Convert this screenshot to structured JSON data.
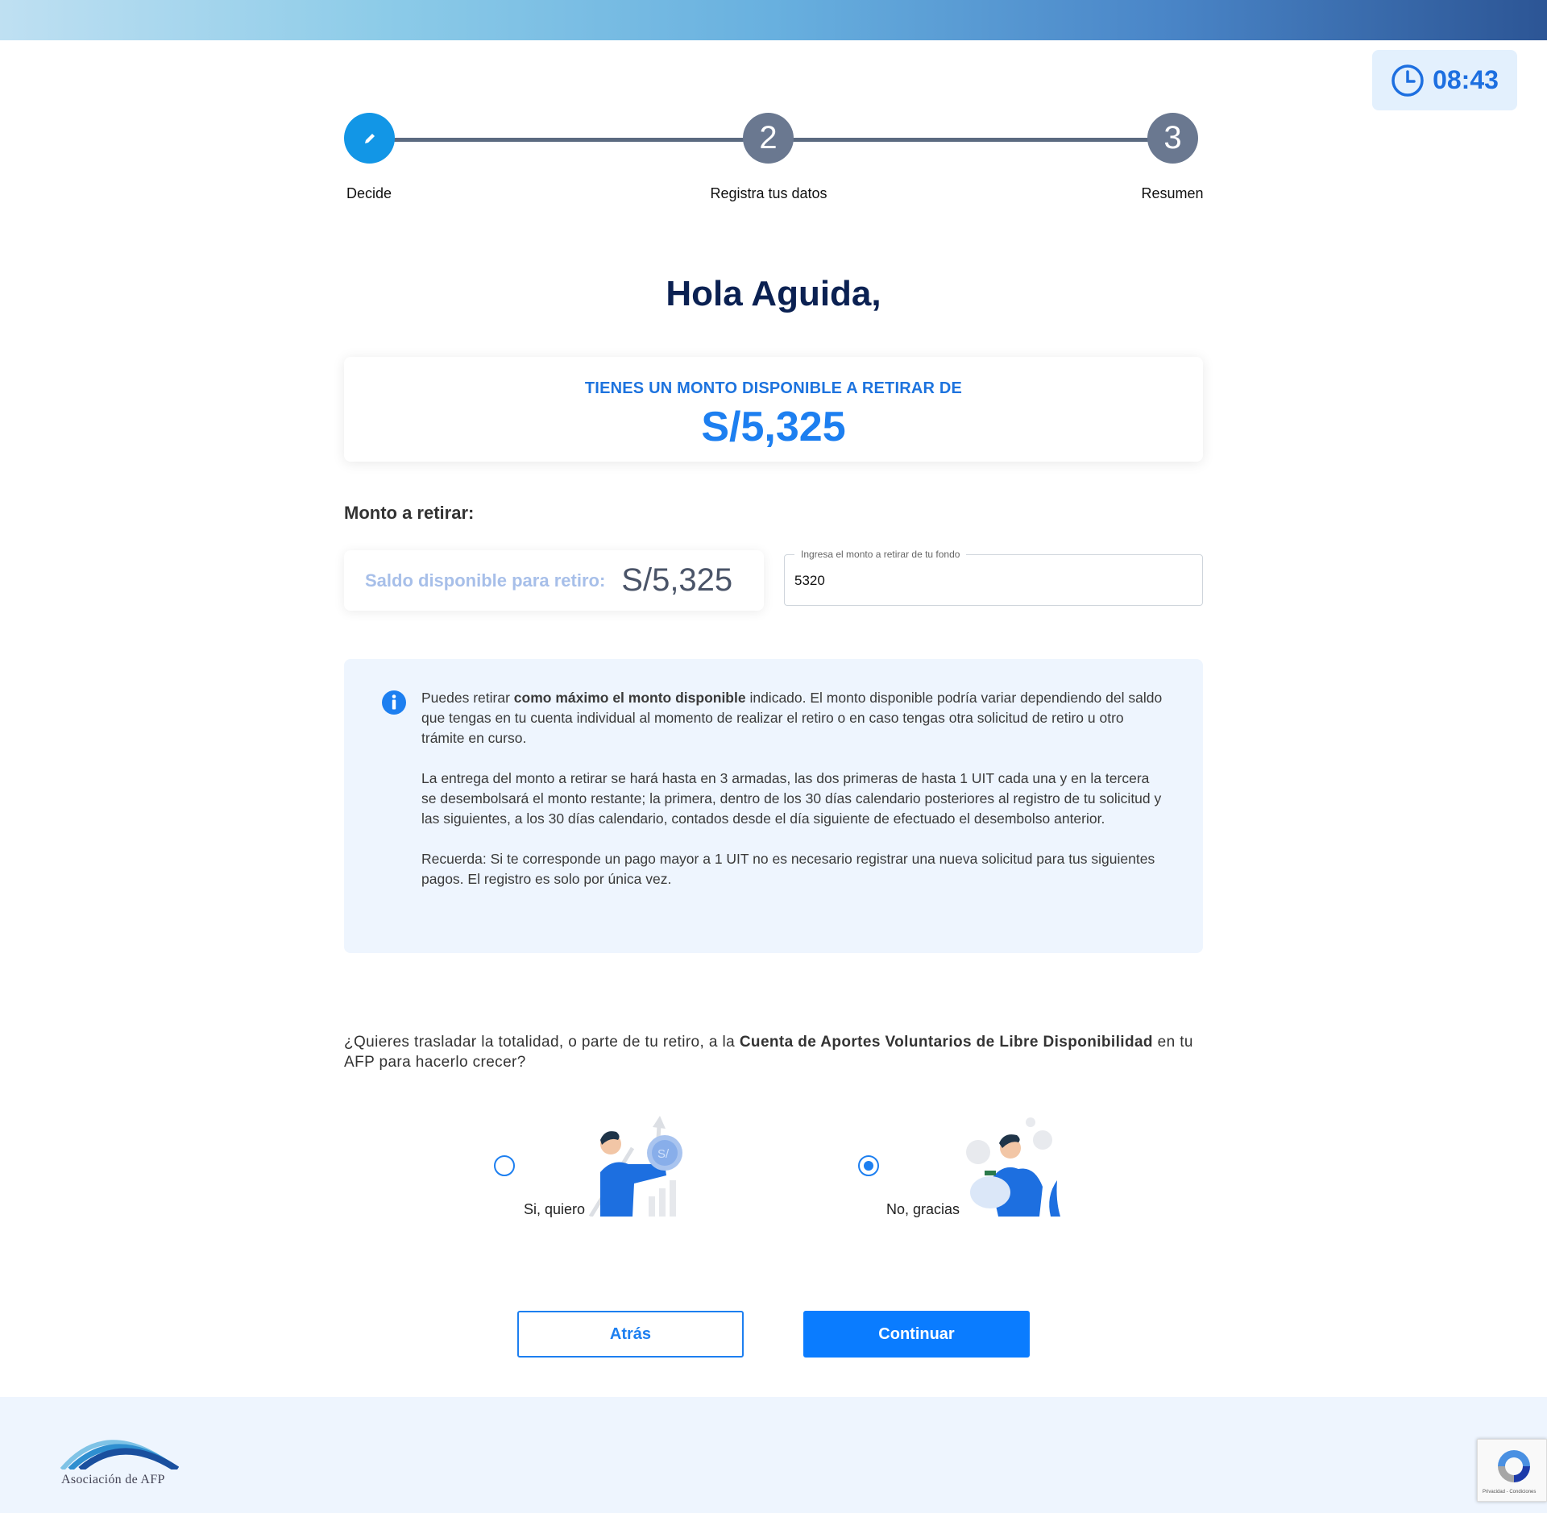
{
  "timer": {
    "value": "08:43",
    "icon": "clock-icon"
  },
  "stepper": {
    "steps": [
      {
        "number": "",
        "label": "Decide",
        "state": "active",
        "icon": "pencil-icon"
      },
      {
        "number": "2",
        "label": "Registra tus datos",
        "state": "pending"
      },
      {
        "number": "3",
        "label": "Resumen",
        "state": "pending"
      }
    ]
  },
  "greeting": "Hola Aguida,",
  "available_card": {
    "label": "TIENES UN MONTO DISPONIBLE A RETIRAR DE",
    "amount": "S/5,325"
  },
  "withdraw": {
    "title": "Monto a retirar:",
    "balance_label": "Saldo disponible para retiro:",
    "balance_value": "S/5,325",
    "input_label": "Ingresa el monto a retirar de tu fondo",
    "input_value": "5320"
  },
  "info": {
    "icon": "info-icon",
    "p1_pre": "Puedes retirar ",
    "p1_bold": "como máximo el monto disponible",
    "p1_post": " indicado. El monto disponible podría variar dependiendo del saldo que tengas en tu cuenta individual al momento de realizar el retiro o en caso tengas otra solicitud de retiro u otro trámite en curso.",
    "p2": "La entrega del monto a retirar se hará hasta en 3 armadas, las dos primeras de hasta 1 UIT cada una y en la tercera se desembolsará el monto restante; la primera, dentro de los 30 días calendario posteriores al registro de tu solicitud y las siguientes, a los 30 días calendario, contados desde el día siguiente de efectuado el desembolso anterior.",
    "p3": "Recuerda: Si te corresponde un pago mayor a 1 UIT no es necesario registrar una nueva solicitud para tus siguientes pagos. El registro es solo por única vez."
  },
  "question": {
    "pre": "¿Quieres trasladar la totalidad, o parte de tu retiro, a la ",
    "bold": "Cuenta de Aportes Voluntarios de Libre Disponibilidad",
    "post": " en tu AFP para hacerlo crecer?"
  },
  "options": [
    {
      "label": "Si, quiero",
      "checked": false,
      "illustration": "person-holding-coin-illustration"
    },
    {
      "label": "No, gracias",
      "checked": true,
      "illustration": "person-with-piggy-bank-illustration"
    }
  ],
  "buttons": {
    "back": "Atrás",
    "continue": "Continuar"
  },
  "footer": {
    "logo_text": "Asociación de AFP"
  },
  "recaptcha": {
    "text": "Privacidad - Condiciones"
  },
  "colors": {
    "primary": "#1d7ff0",
    "navy": "#0b2152",
    "info_bg": "#eef5fe",
    "step_idle": "#6a7890",
    "step_active": "#1296e6"
  }
}
